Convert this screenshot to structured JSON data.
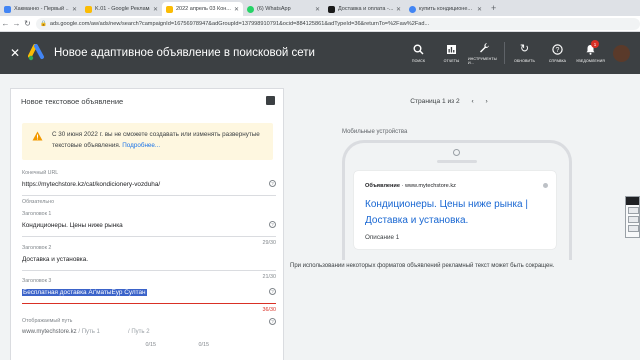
{
  "browser": {
    "tabs": [
      {
        "title": "Хакманно - Первый ...",
        "color": "#4285f4"
      },
      {
        "title": "K.01 - Google Реклама",
        "color": "#fbbc04"
      },
      {
        "title": "2022 апрель 03 Кон...",
        "color": "#fbbc04"
      },
      {
        "title": "(6) WhatsApp",
        "color": "#25d366"
      },
      {
        "title": "Доставка и оплата -...",
        "color": "#1a1a1a"
      },
      {
        "title": "купить кондиционе...",
        "color": "#4285f4"
      }
    ],
    "url": "ads.google.com/aw/ads/new/search?campaignId=16756978947&adGroupId=137998910791&ocid=884125861&adTypeId=36&returnTo=%2Faw%2Fad..."
  },
  "header": {
    "title": "Новое адаптивное объявление в поисковой сети",
    "tools": [
      {
        "icon": "search-icon",
        "label": "ПОИСК"
      },
      {
        "icon": "reports-icon",
        "label": "ОТЧЕТЫ"
      },
      {
        "icon": "tools-icon",
        "label": "ИНСТРУМЕНТЫ И..."
      },
      {
        "icon": "refresh-icon",
        "label": "ОБНОВИТЬ"
      },
      {
        "icon": "help-icon",
        "label": "СПРАВКА"
      },
      {
        "icon": "bell-icon",
        "label": "УВЕДОМЛЕНИЯ"
      }
    ],
    "notifications_count": "1"
  },
  "form": {
    "card_title": "Новое текстовое объявление",
    "warning": {
      "text": "С 30 июня 2022 г. вы не сможете создавать или изменять развернутые текстовые объявления.",
      "link": "Подробнее..."
    },
    "final_url": {
      "label": "Конечный URL",
      "value": "https://mytechstore.kz/cat/kondicionery-vozduha/"
    },
    "required_label": "Обязательно",
    "headline1": {
      "label": "Заголовок 1",
      "value": "Кондиционеры. Цены ниже рынка",
      "counter": "29/30"
    },
    "headline2": {
      "label": "Заголовок 2",
      "value": "Доставка и установка.",
      "counter": "21/30"
    },
    "headline3": {
      "label": "Заголовок 3",
      "value": "Бесплатная доставка Аг'матыЕур Султан",
      "counter": "36/30"
    },
    "display_path": {
      "label": "Отображаемый путь",
      "base": "www.mytechstore.kz",
      "path1_placeholder": "/ Путь 1",
      "path2_placeholder": "/ Путь 2",
      "counter1": "0/15",
      "counter2": "0/15"
    }
  },
  "preview": {
    "pager": "Страница 1 из 2",
    "mobile_label": "Мобильные устройства",
    "ad_label": "Объявление",
    "ad_domain": "www.mytechstore.kz",
    "headline": "Кондиционеры. Цены ниже рынка | Доставка и установка.",
    "description": "Описание 1",
    "note": "При использовании некоторых форматов объявлений рекламный текст может быть сокращен.",
    "note_link": "Подробнее..."
  }
}
